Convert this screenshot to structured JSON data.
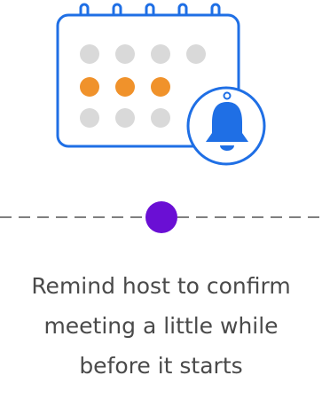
{
  "illustration": {
    "icon": "calendar-with-bell-icon",
    "colors": {
      "outline": "#1f6fe5",
      "accent": "#f0922b",
      "inactive": "#d9d9d9",
      "bell": "#1f6fe5"
    }
  },
  "timeline": {
    "node_color": "#6a0fd4",
    "line_color": "#555555"
  },
  "caption": {
    "lines": [
      "Remind host to confirm",
      "meeting a little while",
      "before it starts"
    ],
    "color": "#4a4a4a"
  }
}
